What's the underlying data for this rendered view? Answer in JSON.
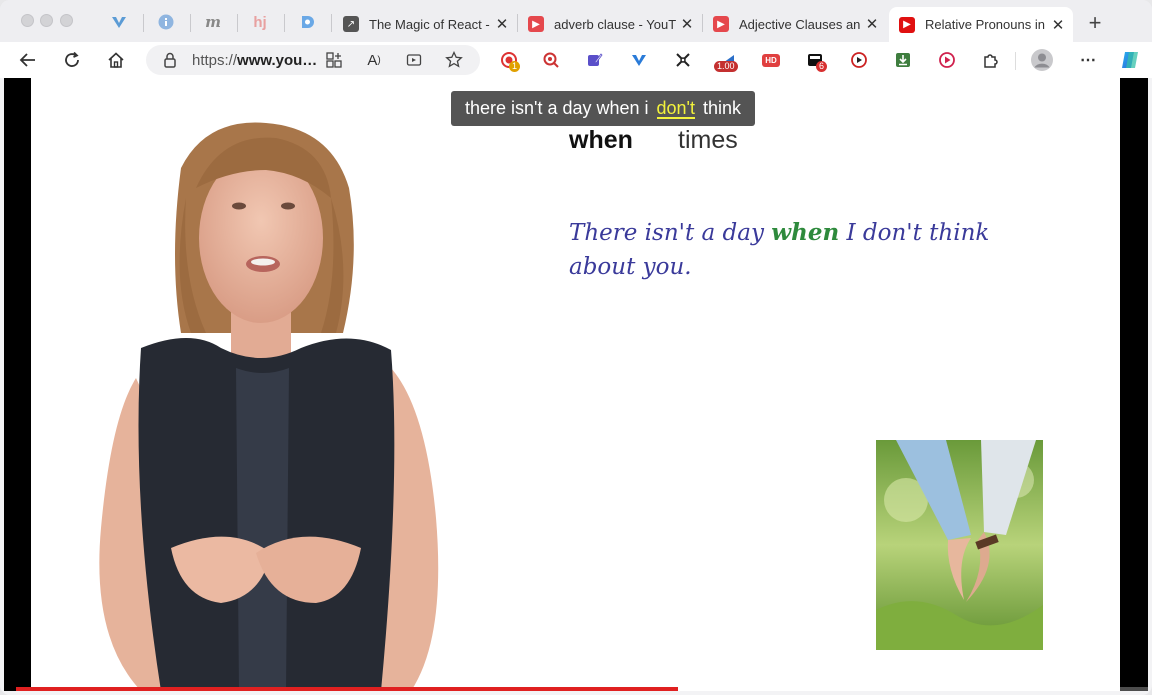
{
  "tabs": [
    {
      "title": "The Magic of React -",
      "favicon": "arrow-link-icon",
      "color": "#555555",
      "active": false
    },
    {
      "title": "adverb clause - YouT",
      "favicon": "youtube-icon",
      "color": "#e5484d",
      "active": false
    },
    {
      "title": "Adjective Clauses an",
      "favicon": "youtube-icon",
      "color": "#e5484d",
      "active": false
    },
    {
      "title": "Relative Pronouns in",
      "favicon": "youtube-icon",
      "color": "#e01010",
      "active": true
    }
  ],
  "toolbar": {
    "url_prefix": "https://",
    "url_host": "www.you…",
    "ext_badges": {
      "recorder": "1",
      "speed": "1.00",
      "hd": "HD",
      "notifications": "6"
    }
  },
  "video": {
    "caption_before": "there isn't a day when i",
    "caption_highlight": "don't",
    "caption_after": "think",
    "word1": "when",
    "word2": "times",
    "sentence_part1": "There isn't a day",
    "sentence_highlight": "when",
    "sentence_part2": "I don't think about you.",
    "progress": 0.585
  },
  "colors": {
    "accent_red": "#e02020",
    "caption_highlight": "#f2f23c",
    "sentence": "#3a3a9a",
    "sentence_highlight": "#2e8a3c"
  }
}
